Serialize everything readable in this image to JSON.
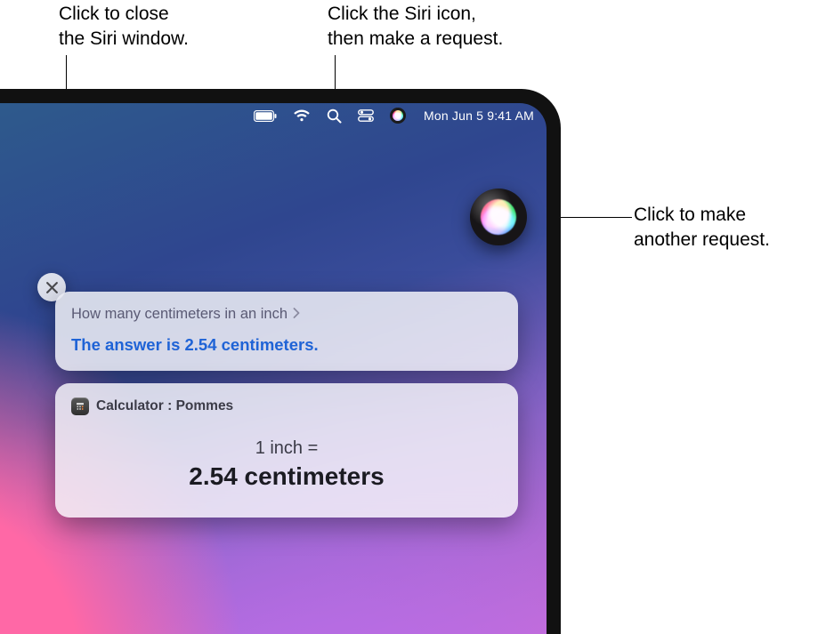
{
  "callouts": {
    "close": "Click to close\nthe Siri window.",
    "menu_siri": "Click the Siri icon,\nthen make a request.",
    "orb": "Click to make\nanother request."
  },
  "menubar": {
    "datetime": "Mon Jun 5  9:41 AM"
  },
  "siri_card": {
    "query": "How many centimeters in an inch",
    "answer": "The answer is 2.54 centimeters."
  },
  "calc_card": {
    "title": "Calculator : Pommes",
    "line1": "1 inch =",
    "line2": "2.54 centimeters"
  }
}
